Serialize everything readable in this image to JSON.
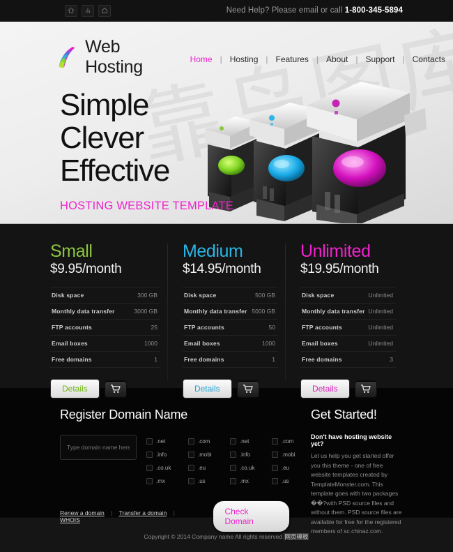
{
  "topbar": {
    "icons": [
      "home-icon",
      "rss-icon",
      "mail-icon"
    ],
    "help_prefix": "Need Help? Please email or call ",
    "phone": "1-800-345-5894"
  },
  "header": {
    "logo_text": "Web Hosting",
    "logo_icon": "feather-leaf-logo",
    "watermark": "靠鸟图库",
    "nav": [
      {
        "label": "Home",
        "active": true
      },
      {
        "label": "Hosting",
        "active": false
      },
      {
        "label": "Features",
        "active": false
      },
      {
        "label": "About",
        "active": false
      },
      {
        "label": "Support",
        "active": false
      },
      {
        "label": "Contacts",
        "active": false
      }
    ]
  },
  "hero": {
    "line1": "Simple",
    "line2": "Clever",
    "line3": "Effective",
    "tagline": "HOSTING WEBSITE TEMPLATE",
    "artwork": "three-servers-illustration"
  },
  "pricing": {
    "feature_labels": [
      "Disk space",
      "Monthly data transfer",
      "FTP accounts",
      "Email boxes",
      "Free domains"
    ],
    "details_label": "Details",
    "cart_icon": "shopping-cart-icon",
    "plans": [
      {
        "name": "Small",
        "color": "#8cc63e",
        "price": "$9.95/month",
        "values": [
          "300 GB",
          "3000 GB",
          "25",
          "1000",
          "1"
        ]
      },
      {
        "name": "Medium",
        "color": "#29b6e8",
        "price": "$14.95/month",
        "values": [
          "500 GB",
          "5000 GB",
          "50",
          "1000",
          "1"
        ]
      },
      {
        "name": "Unlimited",
        "color": "#ee22cc",
        "price": "$19.95/month",
        "values": [
          "Unlimited",
          "Unlimited",
          "Unlimited",
          "Unlimited",
          "3"
        ]
      }
    ]
  },
  "register": {
    "title": "Register Domain Name",
    "input_placeholder": "Type domain name here",
    "input_value": "",
    "tld_columns": [
      [
        ".net",
        ".info",
        ".co.uk",
        ".mx"
      ],
      [
        ".com",
        ".mobi",
        ".eu",
        ".us"
      ],
      [
        ".net",
        ".info",
        ".co.uk",
        ".mx"
      ],
      [
        ".com",
        ".mobi",
        ".eu",
        ".us"
      ]
    ],
    "links": [
      "Renew a domain",
      "Transfer a domain",
      "WHOIS"
    ],
    "separator": "|",
    "check_button": "Check Domain"
  },
  "started": {
    "title": "Get Started!",
    "subtitle": "Don't have hosting website yet?",
    "body": "Let us help you get started offer you this theme - one of free website templates created by TemplateMonster.com. This template goes with two packages ��?with PSD source files and without them. PSD source files are available for free for the registered members of sc.chinaz.com."
  },
  "footer": {
    "copyright": "Copyright © 2014 Company name All rights reserved ",
    "cn_mark": "网页模板"
  }
}
